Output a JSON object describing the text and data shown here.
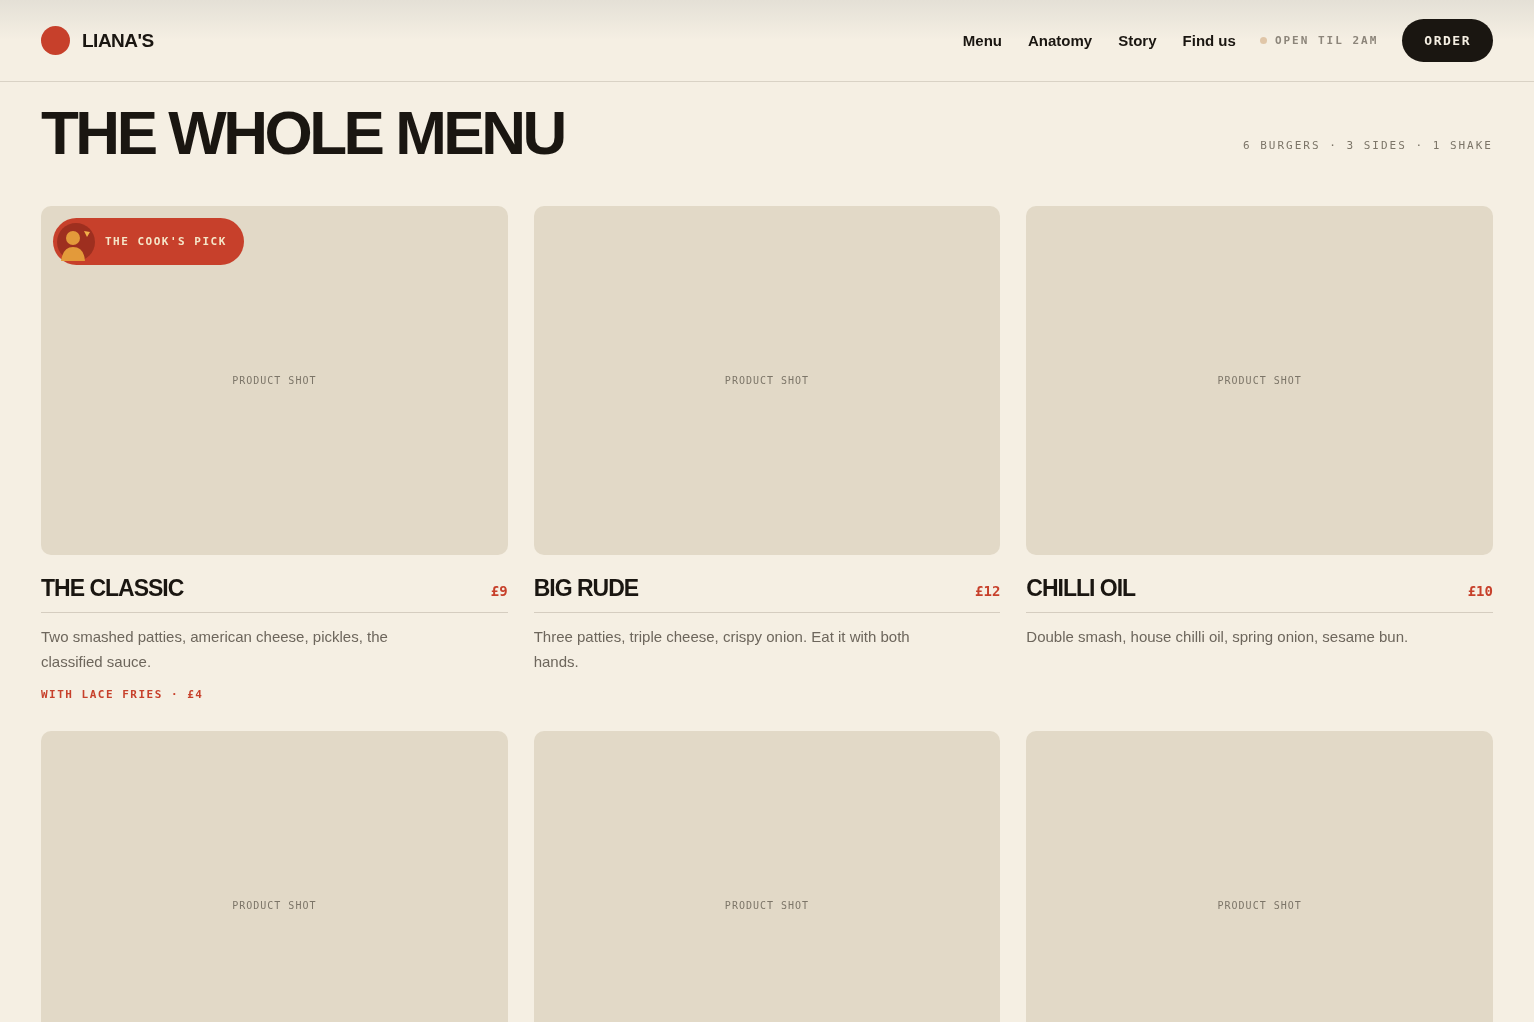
{
  "brand": {
    "name": "LIANA'S"
  },
  "nav": {
    "links": [
      "Menu",
      "Anatomy",
      "Story",
      "Find us"
    ],
    "status": "OPEN TIL 2AM",
    "order_button": "ORDER"
  },
  "page": {
    "title": "THE WHOLE MENU",
    "summary": "6 BURGERS · 3 SIDES · 1 SHAKE"
  },
  "items": [
    {
      "image_label": "PRODUCT SHOT",
      "badge": "THE COOK'S PICK",
      "name": "THE CLASSIC",
      "price": "£9",
      "description": "Two smashed patties, american cheese, pickles, the classified sauce.",
      "extra": "WITH LACE FRIES · £4"
    },
    {
      "image_label": "PRODUCT SHOT",
      "name": "BIG RUDE",
      "price": "£12",
      "description": "Three patties, triple cheese, crispy onion. Eat it with both hands."
    },
    {
      "image_label": "PRODUCT SHOT",
      "name": "CHILLI OIL",
      "price": "£10",
      "description": "Double smash, house chilli oil, spring onion, sesame bun."
    },
    {
      "image_label": "PRODUCT SHOT"
    },
    {
      "image_label": "PRODUCT SHOT"
    },
    {
      "image_label": "PRODUCT SHOT"
    }
  ]
}
